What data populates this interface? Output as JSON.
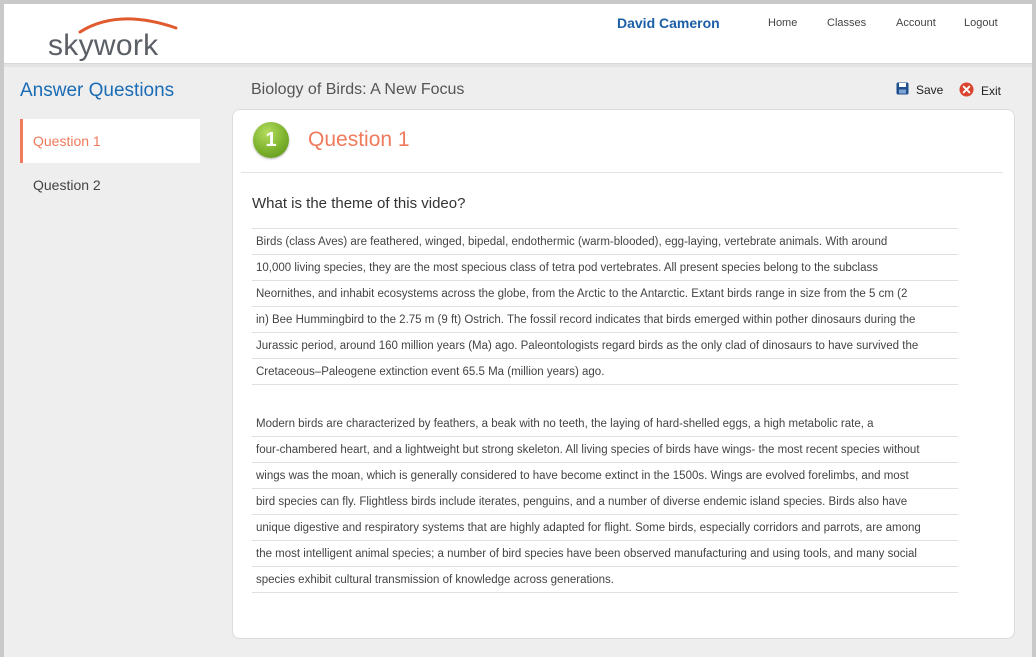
{
  "header": {
    "logo_text": "skywork",
    "user_name": "David Cameron",
    "nav": [
      "Home",
      "Classes",
      "Account",
      "Logout"
    ]
  },
  "sidebar": {
    "title": "Answer Questions",
    "items": [
      {
        "label": "Question 1",
        "active": true
      },
      {
        "label": "Question 2",
        "active": false
      }
    ]
  },
  "main": {
    "course_title": "Biology of Birds: A New Focus",
    "save_label": "Save",
    "exit_label": "Exit",
    "question_number": "1",
    "question_title": "Question 1",
    "question_text": "What is the theme of this video?",
    "answer_paragraphs": [
      [
        "Birds (class Aves) are feathered, winged, bipedal, endothermic (warm-blooded), egg-laying, vertebrate animals. With around",
        "10,000 living species, they are the most specious class of tetra pod vertebrates. All present species belong to the subclass",
        "Neornithes, and inhabit ecosystems across the globe, from the Arctic to the Antarctic. Extant birds range in size from the 5 cm (2",
        "in) Bee Hummingbird to the 2.75 m (9 ft) Ostrich. The fossil record indicates that birds emerged within pother dinosaurs during the",
        "Jurassic period, around 160 million years (Ma) ago. Paleontologists regard birds as the only clad of dinosaurs to have survived the",
        "Cretaceous–Paleogene extinction event 65.5 Ma (million years) ago."
      ],
      [
        "Modern birds are characterized by feathers, a beak with no teeth, the laying of hard-shelled eggs, a high metabolic rate, a",
        "four-chambered heart, and a lightweight but strong skeleton. All living species of birds have wings- the most recent species without",
        "wings was the moan, which is generally considered to have become extinct in the 1500s. Wings are evolved forelimbs, and most",
        "bird species can fly. Flightless birds include iterates, penguins, and a number of diverse endemic island species. Birds also have",
        "unique digestive and respiratory systems that are highly adapted for flight. Some birds, especially corridors and parrots, are among",
        "the most intelligent animal species; a number of bird species have been observed manufacturing and using tools, and many social",
        "species exhibit cultural transmission of knowledge across generations."
      ]
    ]
  },
  "colors": {
    "accent_orange": "#f07a5c",
    "brand_blue": "#1a6cb5",
    "badge_green": "#7cb22c",
    "exit_red": "#d9452f"
  },
  "icons": {
    "save": "floppy-disk-icon",
    "exit": "close-circle-icon",
    "logo_arc": "swoosh-icon"
  }
}
